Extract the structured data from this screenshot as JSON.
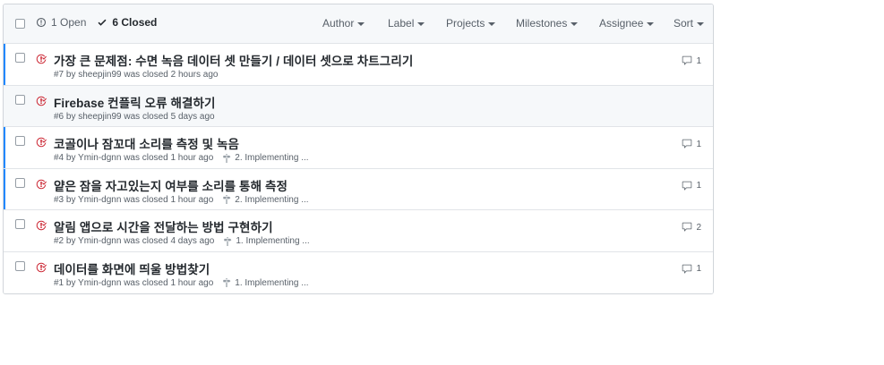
{
  "header": {
    "open_label": "1 Open",
    "closed_label": "6 Closed",
    "filters": {
      "author": "Author",
      "label": "Label",
      "projects": "Projects",
      "milestones": "Milestones",
      "assignee": "Assignee",
      "sort": "Sort"
    }
  },
  "colors": {
    "closed_icon": "#cb2431",
    "unread_bar": "#2188ff",
    "muted_text": "#586069"
  },
  "issues": [
    {
      "title": "가장 큰 문제점: 수면 녹음 데이터 셋 만들기 / 데이터 셋으로 차트그리기",
      "meta": "#7 by sheepjin99 was closed 2 hours ago",
      "milestone": "",
      "comments": "1",
      "unread": true,
      "highlight": false
    },
    {
      "title": "Firebase 컨플릭 오류 해결하기",
      "meta": "#6 by sheepjin99 was closed 5 days ago",
      "milestone": "",
      "comments": "",
      "unread": false,
      "highlight": true
    },
    {
      "title": "코골이나 잠꼬대 소리를 측정 및 녹음",
      "meta": "#4 by Ymin-dgnn was closed 1 hour ago",
      "milestone": "2. Implementing ...",
      "comments": "1",
      "unread": true,
      "highlight": false
    },
    {
      "title": "얕은 잠을 자고있는지 여부를 소리를 통해 측정",
      "meta": "#3 by Ymin-dgnn was closed 1 hour ago",
      "milestone": "2. Implementing ...",
      "comments": "1",
      "unread": true,
      "highlight": false
    },
    {
      "title": "알림 앱으로 시간을 전달하는 방법 구현하기",
      "meta": "#2 by Ymin-dgnn was closed 4 days ago",
      "milestone": "1. Implementing ...",
      "comments": "2",
      "unread": false,
      "highlight": false
    },
    {
      "title": "데이터를 화면에 띄울 방법찾기",
      "meta": "#1 by Ymin-dgnn was closed 1 hour ago",
      "milestone": "1. Implementing ...",
      "comments": "1",
      "unread": false,
      "highlight": false
    }
  ]
}
